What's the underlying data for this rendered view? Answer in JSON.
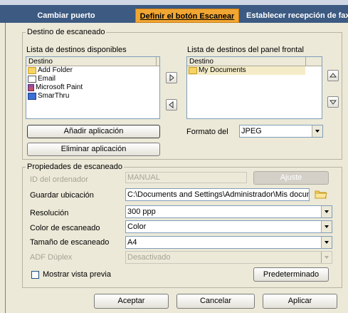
{
  "tabs": [
    {
      "label": "Cambiar puerto"
    },
    {
      "label": "Definir el botón Escanear"
    },
    {
      "label": "Establecer recepción de fax"
    }
  ],
  "scan_destination": {
    "legend": "Destino de escaneado",
    "available_title": "Lista de destinos disponibles",
    "available_header": "Destino",
    "available_items": [
      {
        "label": "Add Folder",
        "icon": "folder-icon"
      },
      {
        "label": "Email",
        "icon": "envelope-icon"
      },
      {
        "label": "Microsoft Paint",
        "icon": "paint-icon"
      },
      {
        "label": "SmarThru",
        "icon": "smarthru-icon"
      }
    ],
    "front_title": "Lista de destinos del panel frontal",
    "front_header": "Destino",
    "front_items": [
      {
        "label": "My Documents",
        "icon": "folder-icon"
      }
    ],
    "add_app_label": "Añadir aplicación",
    "remove_app_label": "Eliminar aplicación",
    "format_label": "Formato del",
    "format_value": "JPEG"
  },
  "scan_properties": {
    "legend": "Propiedades de escaneado",
    "pc_id_label": "ID del ordenador",
    "pc_id_value": "MANUAL",
    "adjust_label": "Ajuste",
    "save_location_label": "Guardar ubicación",
    "save_location_value": "C:\\Documents and Settings\\Administrador\\Mis docume",
    "resolution_label": "Resolución",
    "resolution_value": "300 ppp",
    "color_label": "Color de escaneado",
    "color_value": "Color",
    "size_label": "Tamaño de escaneado",
    "size_value": "A4",
    "adf_label": "ADF Dúplex",
    "adf_value": "Desactivado",
    "preview_label": "Mostrar vista previa",
    "default_label": "Predeterminado"
  },
  "footer": {
    "accept_label": "Aceptar",
    "cancel_label": "Cancelar",
    "apply_label": "Aplicar"
  },
  "colors": {
    "tab_bar": "#3c5a82",
    "active_tab": "#f2a632"
  }
}
